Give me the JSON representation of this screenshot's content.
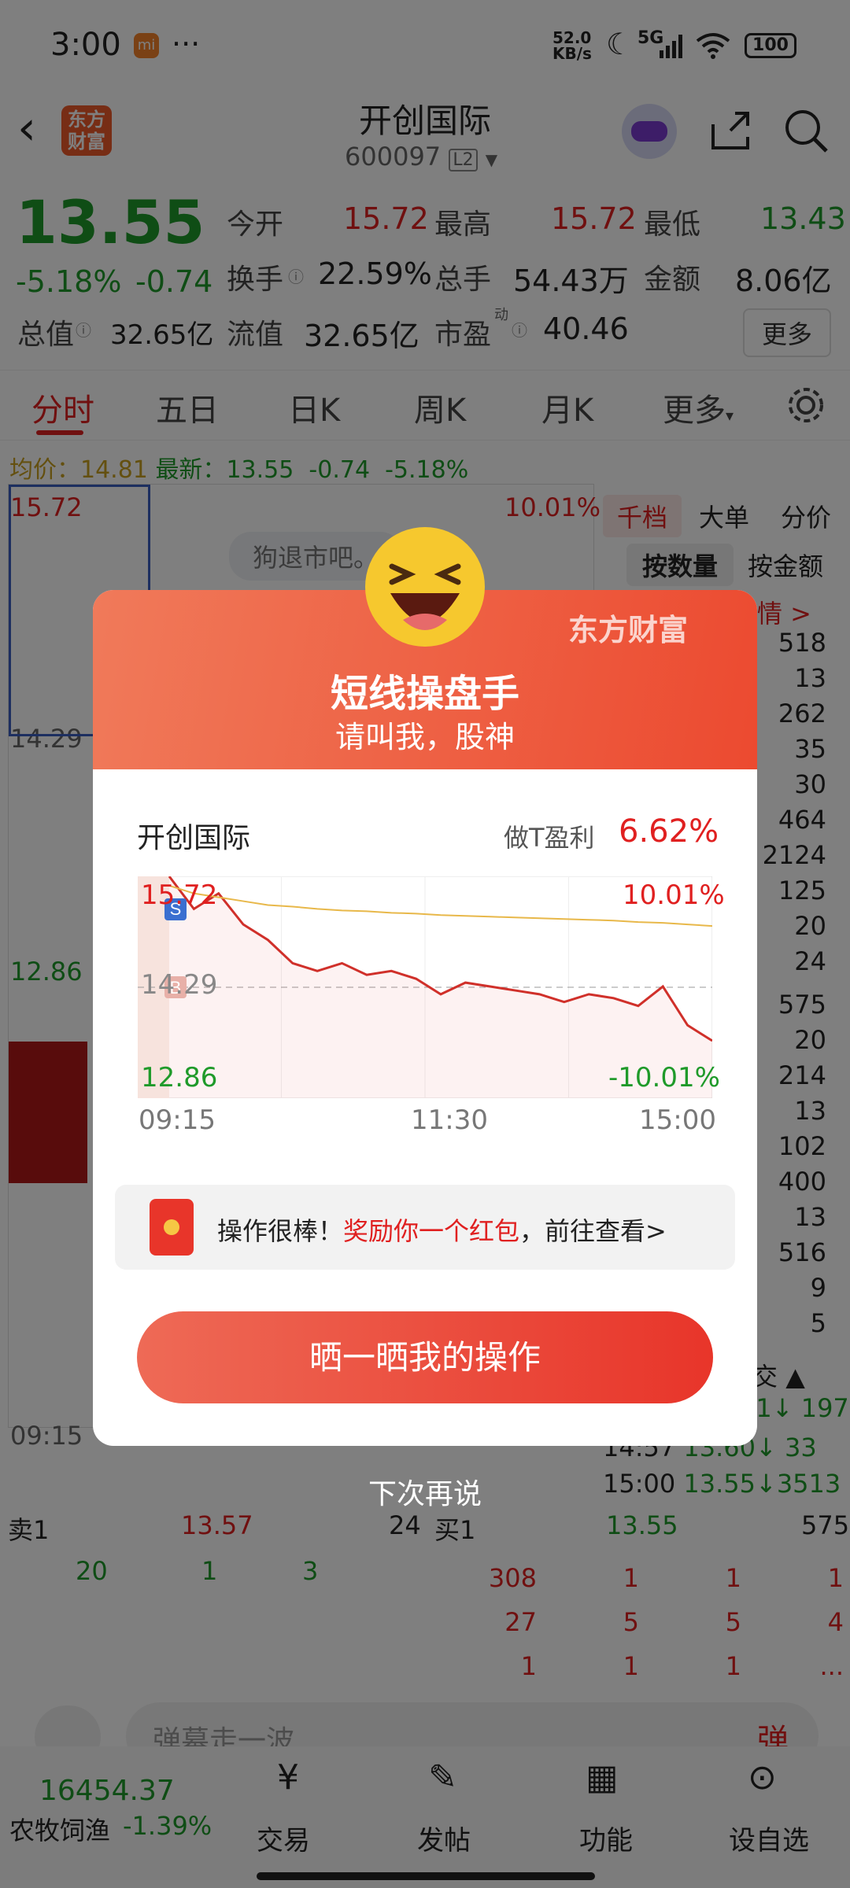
{
  "status_bar": {
    "time": "3:00",
    "net_speed_value": "52.0",
    "net_speed_unit": "KB/s",
    "signal": "5G",
    "battery": "100",
    "mi_label": "mi",
    "dots": "···"
  },
  "header": {
    "logo_line1": "东方",
    "logo_line2": "财富",
    "stock_name": "开创国际",
    "stock_code": "600097",
    "level_badge": "L2"
  },
  "quote": {
    "price": "13.55",
    "change_pct": "-5.18%",
    "change": "-0.74",
    "open_label": "今开",
    "open": "15.72",
    "high_label": "最高",
    "high": "15.72",
    "low_label": "最低",
    "low": "13.43",
    "turnover_label": "换手",
    "turnover": "22.59%",
    "volume_label": "总手",
    "volume": "54.43万",
    "amount_label": "金额",
    "amount": "8.06亿",
    "mktcap_label": "总值",
    "mktcap": "32.65亿",
    "float_label": "流值",
    "float": "32.65亿",
    "pe_label": "市盈",
    "pe_sup": "动",
    "pe": "40.46",
    "more": "更多"
  },
  "tabs": {
    "items": [
      "分时",
      "五日",
      "日K",
      "周K",
      "月K"
    ],
    "more": "更多"
  },
  "avg_line": {
    "label": "均价：",
    "value": "14.81",
    "latest_label": "最新：",
    "latest": "13.55",
    "chg": "-0.74",
    "pct": "-5.18%"
  },
  "bg_chart": {
    "top_price": "15.72",
    "top_pct": "10.01%",
    "mid_price": "14.29",
    "low_price": "12.86",
    "time_start": "09:15",
    "danmaku": "狗退市吧。"
  },
  "book_tabs": {
    "t1": "千档",
    "t2": "大单",
    "t3": "分价",
    "s1": "按数量",
    "s2": "按金额",
    "link": "情 >"
  },
  "book_sells": [
    "518",
    "13",
    "262",
    "35",
    "30",
    "464",
    "2124",
    "125",
    "20",
    "24"
  ],
  "book_buys": [
    "575",
    "20",
    "214",
    "13",
    "102",
    "400",
    "13",
    "516",
    "9",
    "5"
  ],
  "trades": {
    "header": "交",
    "rows": [
      {
        "time": "14:57",
        "price": "13.60↓",
        "vol": "33"
      },
      {
        "time": "15:00",
        "price": "13.55↓",
        "vol": "3513"
      }
    ],
    "partial_price": "61↓",
    "partial_vol": "197"
  },
  "level1": {
    "sell_label": "卖1",
    "sell_price": "13.57",
    "sell_vol": "24",
    "buy_label": "买1",
    "buy_price": "13.55",
    "buy_vol": "575",
    "sell_detail": [
      "20",
      "1",
      "3"
    ],
    "buy_detail": [
      [
        "308",
        "1",
        "1",
        "1"
      ],
      [
        "27",
        "5",
        "5",
        "4"
      ],
      [
        "1",
        "1",
        "1",
        "..."
      ]
    ]
  },
  "comment_bar": {
    "placeholder": "弹幕走一波...",
    "dan": "弹"
  },
  "bottom_nav": {
    "index_value": "16454.37",
    "index_name": "农牧饲渔",
    "index_pct": "-1.39%",
    "items": [
      "交易",
      "发帖",
      "功能",
      "设自选"
    ]
  },
  "dialog": {
    "brand": "东方财富",
    "title": "短线操盘手",
    "subtitle": "请叫我，股神",
    "stock_name": "开创国际",
    "profit_label": "做T盈利",
    "profit_value": "6.62%",
    "reward_prefix": "操作很棒！",
    "reward_highlight": "奖励你一个红包",
    "reward_suffix": "，前往查看>",
    "share_button": "晒一晒我的操作",
    "later": "下次再说"
  },
  "chart_data": {
    "type": "line",
    "title": "",
    "x_ticks": [
      "09:15",
      "11:30",
      "15:00"
    ],
    "y_left_ticks": [
      "15.72",
      "14.29",
      "12.86"
    ],
    "y_right_ticks": [
      "10.01%",
      "-10.01%"
    ],
    "ylim": [
      12.86,
      15.72
    ],
    "ref_price": 14.29,
    "markers": [
      "S",
      "B"
    ],
    "series": [
      {
        "values": [
          15.72,
          15.3,
          15.5,
          15.1,
          14.9,
          14.6,
          14.5,
          14.6,
          14.45,
          14.5,
          14.4,
          14.2,
          14.35,
          14.3,
          14.25,
          14.2,
          14.1,
          14.2,
          14.15,
          14.05,
          14.3,
          13.8,
          13.6
        ]
      },
      {
        "values": [
          15.6,
          15.5,
          15.45,
          15.4,
          15.35,
          15.33,
          15.3,
          15.28,
          15.27,
          15.25,
          15.24,
          15.22,
          15.21,
          15.2,
          15.19,
          15.18,
          15.17,
          15.16,
          15.15,
          15.13,
          15.12,
          15.1,
          15.08
        ]
      }
    ]
  },
  "colors": {
    "up": "#e02020",
    "down": "#1f9a2a",
    "accent": "#ec4a30",
    "avg_line": "#e8b84a"
  }
}
